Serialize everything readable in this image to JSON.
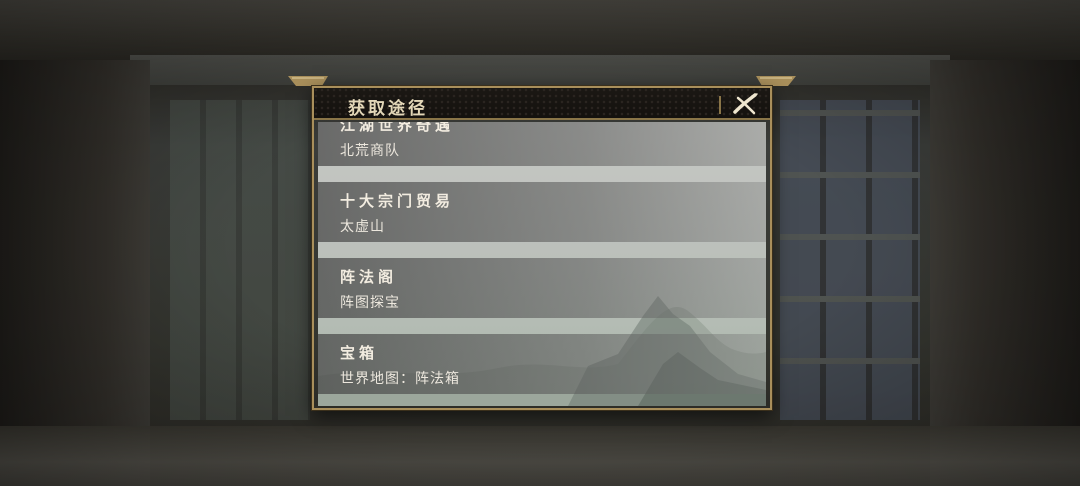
{
  "dialog": {
    "title": "获取途径",
    "close_icon": "close-brush-icon"
  },
  "entries": [
    {
      "title": "江湖世界奇遇",
      "subtitle": "北荒商队"
    },
    {
      "title": "十大宗门贸易",
      "subtitle": "太虚山"
    },
    {
      "title": "阵法阁",
      "subtitle": "阵图探宝"
    },
    {
      "title": "宝箱",
      "subtitle": "世界地图：阵法箱"
    }
  ],
  "colors": {
    "frame_gold": "#a98f5b",
    "title_bar": "#14110e",
    "title_text": "#e3d7b8",
    "entry_text": "#f2ece0"
  }
}
